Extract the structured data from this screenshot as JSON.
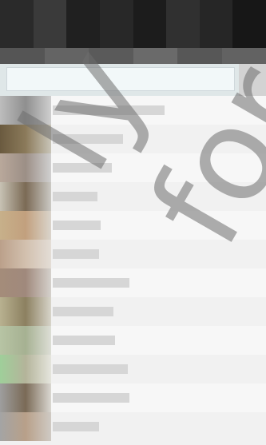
{
  "window": {
    "title": ""
  },
  "search": {
    "placeholder": ""
  },
  "watermark": {
    "text": "ly for"
  },
  "list": {
    "items": [
      {
        "label": ""
      },
      {
        "label": ""
      },
      {
        "label": ""
      },
      {
        "label": ""
      },
      {
        "label": ""
      },
      {
        "label": ""
      },
      {
        "label": ""
      },
      {
        "label": ""
      },
      {
        "label": ""
      },
      {
        "label": ""
      },
      {
        "label": ""
      },
      {
        "label": ""
      }
    ]
  }
}
